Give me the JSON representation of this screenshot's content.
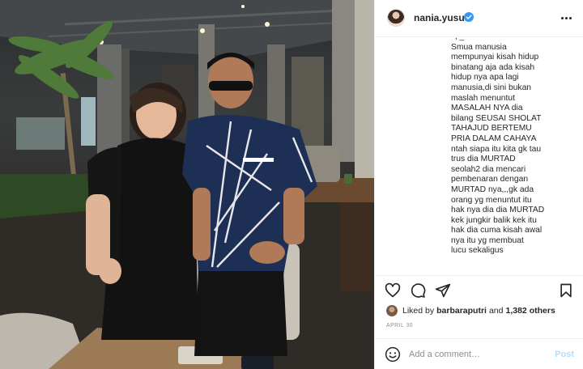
{
  "header": {
    "username": "nania.yusuf",
    "verified_icon": "verified-badge-icon",
    "more_icon": "more-options-icon"
  },
  "caption": {
    "lines": [
      "Smua manusia",
      "mempunyai kisah hidup",
      "binatang aja ada kisah",
      "hidup nya apa lagi",
      "manusia,di sini bukan",
      "maslah menuntut",
      "MASALAH NYA dia",
      "bilang SEUSAI SHOLAT",
      "TAHAJUD BERTEMU",
      "PRIA DALAM CAHAYA",
      "ntah siapa itu kita gk tau",
      "trus dia MURTAD",
      "seolah2 dia mencari",
      "pembenaran dengan",
      "MURTAD nya,,,gk ada",
      "orang yg menuntut itu",
      "hak nya dia dia MURTAD",
      "kek jungkir balik kek itu",
      "hak dia cuma kisah awal",
      "nya itu yg membuat",
      "lucu sekaligus"
    ]
  },
  "actions": {
    "like_icon": "heart-icon",
    "comment_icon": "comment-icon",
    "share_icon": "share-icon",
    "save_icon": "bookmark-icon"
  },
  "likes": {
    "prefix": "Liked by",
    "user": "barbaraputri",
    "conjunction": "and",
    "others": "1,382 others"
  },
  "date": "APRIL 30",
  "comment": {
    "placeholder": "Add a comment…",
    "post_label": "Post",
    "emoji_icon": "emoji-icon"
  },
  "colors": {
    "verified_blue": "#3897f0",
    "post_disabled": "#b2dffc",
    "muted_text": "#8e8e8e"
  }
}
